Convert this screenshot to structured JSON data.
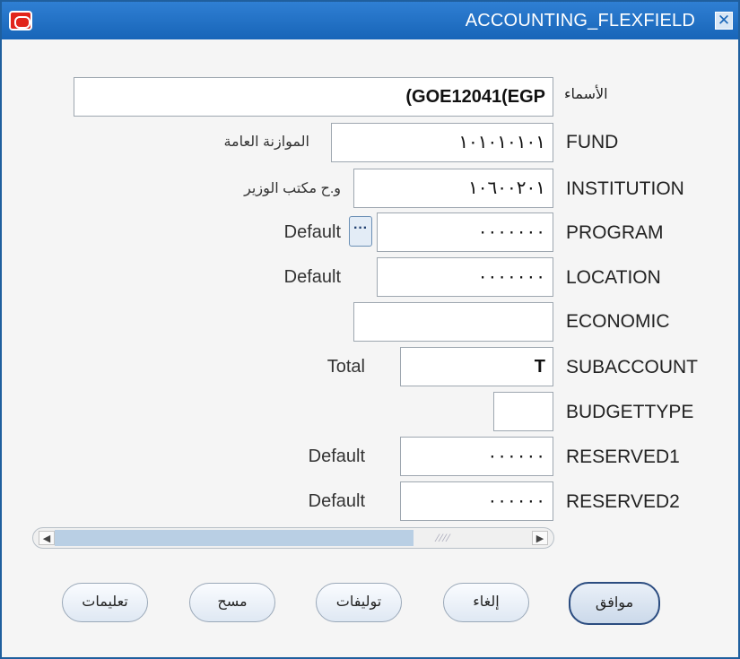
{
  "window": {
    "title": "ACCOUNTING_FLEXFIELD",
    "close_glyph": "✕"
  },
  "fields": {
    "alias": {
      "label": "الأسماء",
      "value": "(GOE12041(EGP"
    },
    "fund": {
      "label": "FUND",
      "value": "١٠١٠١٠١٠١",
      "description": "الموازنة العامة"
    },
    "institution": {
      "label": "INSTITUTION",
      "value": "١٠٦٠٠٢٠١",
      "description": "و.ح مكتب الوزير"
    },
    "program": {
      "label": "PROGRAM",
      "value": "٠٠٠٠٠٠٠",
      "description": "Default",
      "lov_glyph": "···"
    },
    "location": {
      "label": "LOCATION",
      "value": "٠٠٠٠٠٠٠",
      "description": "Default"
    },
    "economic": {
      "label": "ECONOMIC",
      "value": ""
    },
    "subaccount": {
      "label": "SUBACCOUNT",
      "value": "T",
      "description": "Total"
    },
    "budgettype": {
      "label": "BUDGETTYPE",
      "value": ""
    },
    "reserved1": {
      "label": "RESERVED1",
      "value": "٠٠٠٠٠٠",
      "description": "Default"
    },
    "reserved2": {
      "label": "RESERVED2",
      "value": "٠٠٠٠٠٠",
      "description": "Default"
    }
  },
  "scrollbar": {
    "left_arrow": "◀",
    "right_arrow": "▶",
    "grip": "⁄⁄⁄⁄"
  },
  "buttons": {
    "ok": "موافق",
    "cancel": "إلغاء",
    "combinations": "توليفات",
    "clear": "مسح",
    "help": "تعليمات"
  },
  "colors": {
    "titlebar": "#1865b8",
    "oracle_red": "#e1251b"
  }
}
